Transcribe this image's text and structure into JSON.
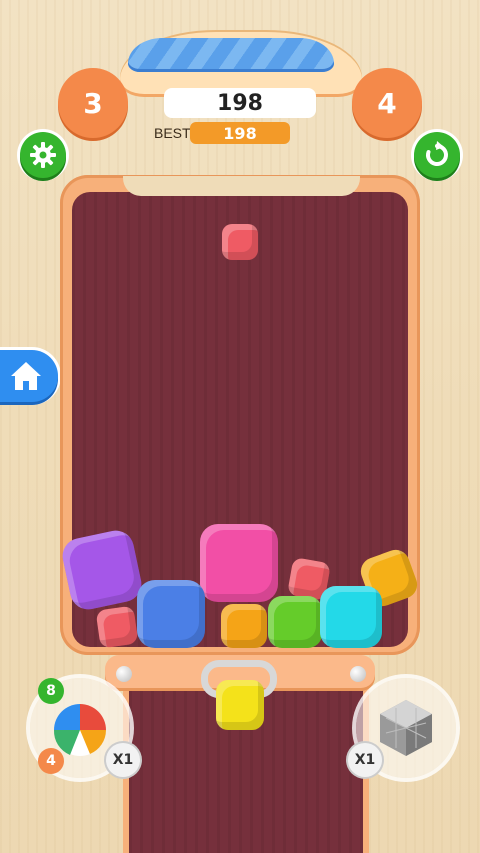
{
  "hud": {
    "current_level": "3",
    "next_level": "4",
    "score": "198",
    "best_label": "BEST",
    "best_score": "198",
    "progress": 1.0
  },
  "buttons": {
    "settings_icon": "gear-icon",
    "restart_icon": "restart-icon",
    "home_icon": "home-icon"
  },
  "boosters": {
    "ball": {
      "count_top": "8",
      "count_bottom": "4",
      "multiplier": "X1"
    },
    "disco": {
      "multiplier": "X1"
    }
  },
  "colors": {
    "board": "#76303c",
    "frame": "#f7b07a",
    "level_badge": "#f4894a",
    "best_badge": "#f39a28",
    "green_button": "#35b52e",
    "home_button": "#2f8ef0"
  }
}
